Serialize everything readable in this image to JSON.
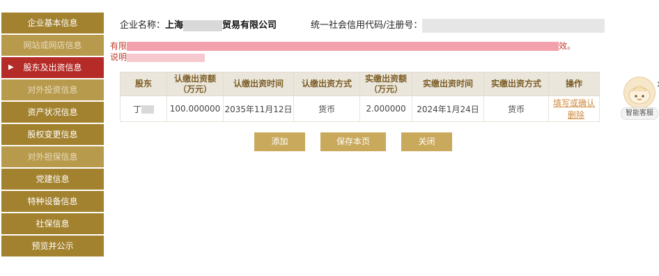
{
  "sidebar": {
    "items": [
      {
        "label": "企业基本信息"
      },
      {
        "label": "网站或网店信息"
      },
      {
        "label": "股东及出资信息"
      },
      {
        "label": "对外投资信息"
      },
      {
        "label": "资产状况信息"
      },
      {
        "label": "股权变更信息"
      },
      {
        "label": "对外担保信息"
      },
      {
        "label": "党建信息"
      },
      {
        "label": "特种设备信息"
      },
      {
        "label": "社保信息"
      },
      {
        "label": "预览并公示"
      }
    ]
  },
  "header": {
    "company_label": "企业名称：",
    "company_prefix": "上海",
    "company_suffix": "贸易有限公司",
    "code_label": "统一社会信用代码/注册号："
  },
  "notice": {
    "line1_start": "有限",
    "line1_end": "效。",
    "line2_start": "说明"
  },
  "table": {
    "headers": [
      "股东",
      "认缴出资额（万元）",
      "认缴出资时间",
      "认缴出资方式",
      "实缴出资额（万元）",
      "实缴出资时间",
      "实缴出资方式",
      "操作"
    ],
    "rows": [
      {
        "shareholder": "丁",
        "subscribed_amount": "100.000000",
        "subscribed_date": "2035年11月12日",
        "subscribed_method": "货币",
        "paid_amount": "2.000000",
        "paid_date": "2024年1月24日",
        "paid_method": "货币",
        "action_edit": "填写或确认",
        "action_delete": "删除"
      }
    ]
  },
  "buttons": {
    "add": "添加",
    "save": "保存本页",
    "close": "关闭"
  },
  "bot": {
    "label": "智能客服",
    "close": "×"
  }
}
